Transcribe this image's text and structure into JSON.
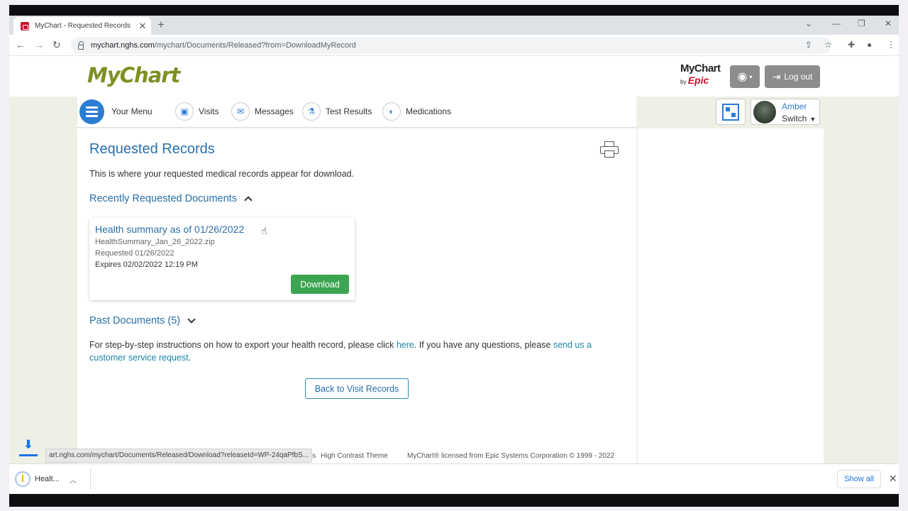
{
  "browser": {
    "tab_title": "MyChart - Requested Records",
    "new_tab": "+",
    "tab_close": "✕",
    "url_host": "mychart.nghs.com",
    "url_path": "/mychart/Documents/Released?from=DownloadMyRecord",
    "back": "←",
    "forward": "→",
    "reload": "↻"
  },
  "header": {
    "logo_text": "MyChart",
    "epic_line1": "MyChart",
    "epic_by": "by",
    "epic_word": "Epic",
    "logout_label": "Log out"
  },
  "nav": {
    "menu_label": "Your Menu",
    "items": [
      {
        "label": "Visits",
        "icon": "calendar-icon"
      },
      {
        "label": "Messages",
        "icon": "envelope-icon"
      },
      {
        "label": "Test Results",
        "icon": "flask-icon"
      },
      {
        "label": "Medications",
        "icon": "pill-icon"
      }
    ],
    "user_name": "Amber",
    "user_switch": "Switch"
  },
  "main": {
    "title": "Requested Records",
    "intro": "This is where your requested medical records appear for download.",
    "recent_heading": "Recently Requested Documents",
    "document": {
      "title": "Health summary as of 01/26/2022",
      "filename": "HealthSummary_Jan_26_2022.zip",
      "requested": "Requested 01/26/2022",
      "expires": "Expires 02/02/2022 12:19 PM",
      "download_label": "Download"
    },
    "past_heading": "Past Documents (5)",
    "instructions_pre": "For step-by-step instructions on how to export your health record, please click ",
    "instructions_link1": "here",
    "instructions_mid": ". If you have any questions, please ",
    "instructions_link2": "send us a customer service request",
    "instructions_post": ".",
    "back_label": "Back to Visit Records"
  },
  "footer": {
    "status_url": "art.nghs.com/mychart/Documents/Released/Download?releaseId=WP-24qaPfbS...",
    "us": "Us",
    "high_contrast": "High Contrast Theme",
    "license": "MyChart® licensed from Epic Systems Corporation © 1999 - 2022"
  },
  "downloads": {
    "item_label": "Healt...",
    "show_all": "Show all",
    "close": "✕"
  },
  "colors": {
    "accent_blue": "#2a6fa8",
    "download_green": "#3da551",
    "logo_olive": "#7f8f20",
    "epic_red": "#c8102e"
  }
}
